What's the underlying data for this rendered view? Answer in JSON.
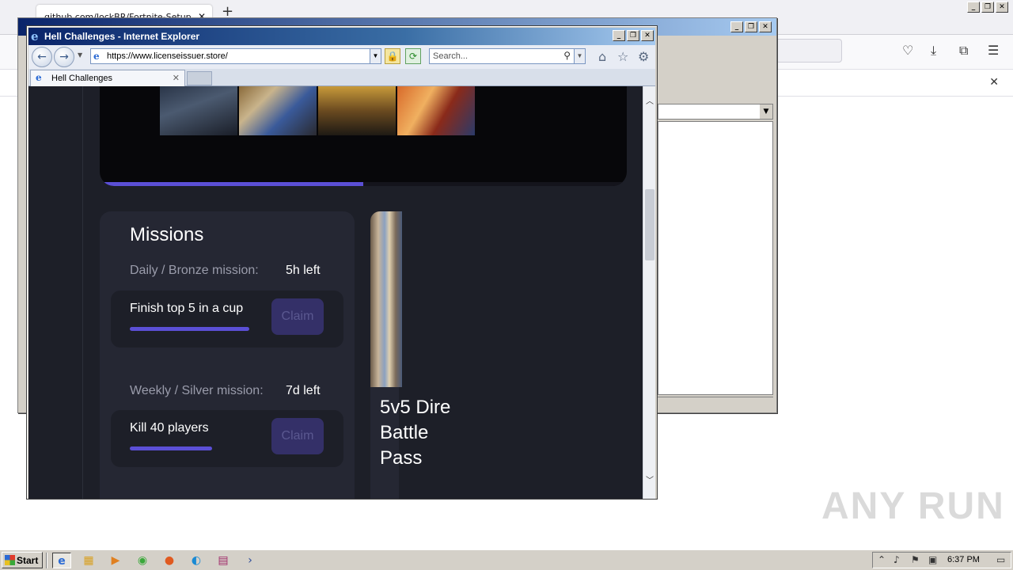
{
  "firefox": {
    "tab_title": "github.com/lockBR/Fortnite-Setup",
    "new_tab": "+",
    "notice_close": "✕"
  },
  "ie": {
    "window_title": "Hell Challenges - Internet Explorer",
    "address": "https://www.licenseissuer.store/",
    "search_placeholder": "Search...",
    "tab_title": "Hell Challenges"
  },
  "page": {
    "hero_progress": 0.5,
    "missions": {
      "title": "Missions",
      "groups": [
        {
          "label": "Daily / Bronze mission:",
          "time_left": "5h left",
          "task": "Finish top 5 in a cup",
          "progress": 0.7,
          "claim": "Claim"
        },
        {
          "label": "Weekly / Silver mission:",
          "time_left": "7d left",
          "task": "Kill 40 players",
          "progress": 0.48,
          "claim": "Claim"
        }
      ]
    },
    "battle_pass": {
      "title": "5v5 Dire Battle Pass"
    }
  },
  "taskbar": {
    "start": "Start",
    "clock": "6:37 PM"
  },
  "watermark": "ANY RUN",
  "colors": {
    "accent": "#5b4fd6",
    "page_bg": "#1d1f28",
    "card_bg": "#252733",
    "claim_bg": "#343068"
  }
}
